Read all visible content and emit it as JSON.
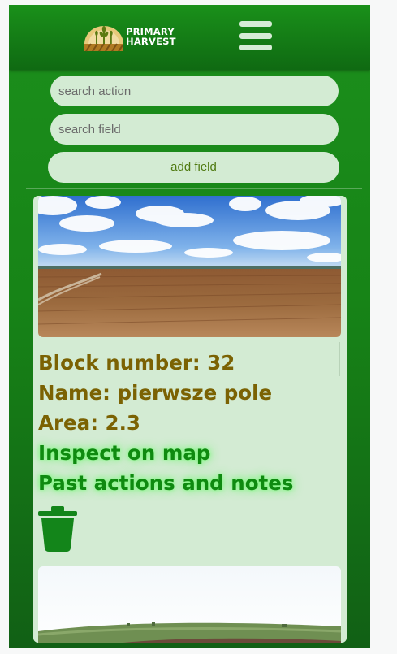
{
  "header": {
    "logo_line1": "PRIMARY",
    "logo_line2": "HARVEST",
    "menu_icon": "hamburger-menu-icon"
  },
  "controls": {
    "search_action_placeholder": "search action",
    "search_field_placeholder": "search field",
    "add_field_label": "add field"
  },
  "fields": [
    {
      "block_number_text": "Block number: 32",
      "name_text": "Name: pierwsze pole",
      "area_text": "Area: 2.3",
      "inspect_link": "Inspect on map",
      "history_link": "Past actions and notes",
      "delete_icon": "trash-icon"
    }
  ],
  "colors": {
    "brand_green": "#178417",
    "panel_background": "#d3ebd3",
    "info_text": "#7b6203",
    "link_text": "#0f8a10"
  }
}
